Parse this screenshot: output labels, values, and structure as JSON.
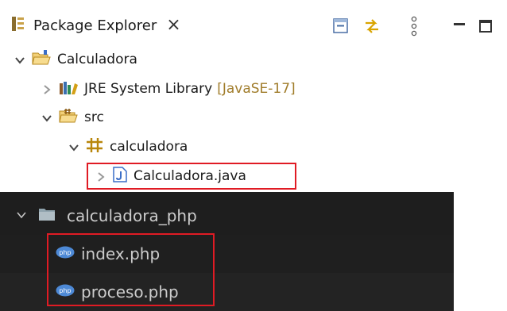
{
  "eclipse": {
    "view_title": "Package Explorer",
    "close_glyph": "×",
    "toolbar": [
      "collapse-all-icon",
      "link-with-editor-icon",
      "view-menu-icon",
      "minimize-icon",
      "maximize-icon"
    ],
    "tree": {
      "project": "Calculadora",
      "jre_label": "JRE System Library",
      "jre_decoration": "[JavaSE-17]",
      "src": "src",
      "package": "calculadora",
      "file": "Calculadora.java"
    }
  },
  "vscode": {
    "folder": "calculadora_php",
    "files": [
      "index.php",
      "proceso.php"
    ]
  },
  "colors": {
    "highlight": "#e01b24",
    "decoration": "#a07c2a",
    "vscode_bg": "#1e1e1e",
    "php_icon": "#4d89d6"
  }
}
